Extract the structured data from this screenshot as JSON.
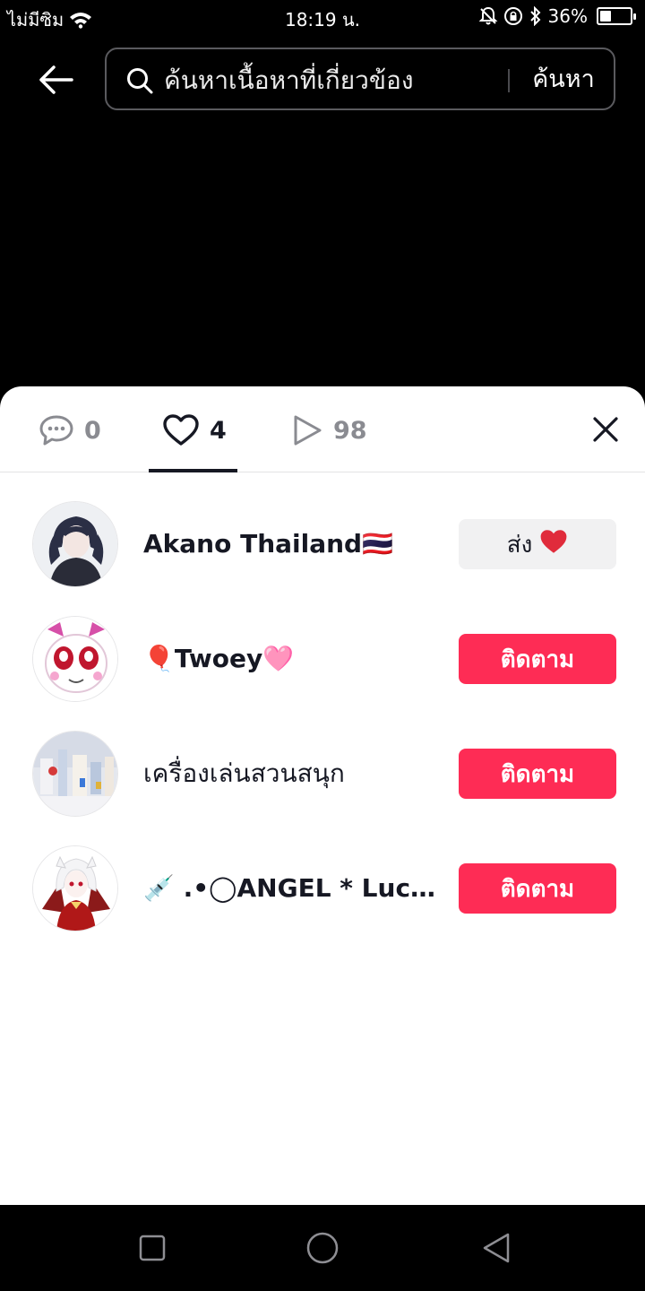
{
  "status_bar": {
    "carrier": "ไม่มีซิม",
    "time": "18:19 น.",
    "battery_percent": "36%",
    "battery_level": 0.36
  },
  "search": {
    "placeholder": "ค้นหาเนื้อหาที่เกี่ยวข้อง",
    "submit_label": "ค้นหา"
  },
  "tabs": {
    "comments_count": "0",
    "likes_count": "4",
    "views_count": "98",
    "active": "likes"
  },
  "users": [
    {
      "name": "Akano Thailand🇹🇭",
      "action": "send",
      "action_label": "ส่ง",
      "action_icon": "heart-icon"
    },
    {
      "name": "🎈Twoey🩷",
      "action": "follow",
      "action_label": "ติดตาม"
    },
    {
      "name": "เครื่องเล่นสวนสนุก",
      "action": "follow",
      "action_label": "ติดตาม"
    },
    {
      "name": "💉 .•◯ANGEL * Luciu...",
      "action": "follow",
      "action_label": "ติดตาม"
    }
  ],
  "colors": {
    "follow_button": "#fe2c55",
    "send_button": "#f1f1f2",
    "background": "#000000",
    "sheet": "#ffffff"
  }
}
